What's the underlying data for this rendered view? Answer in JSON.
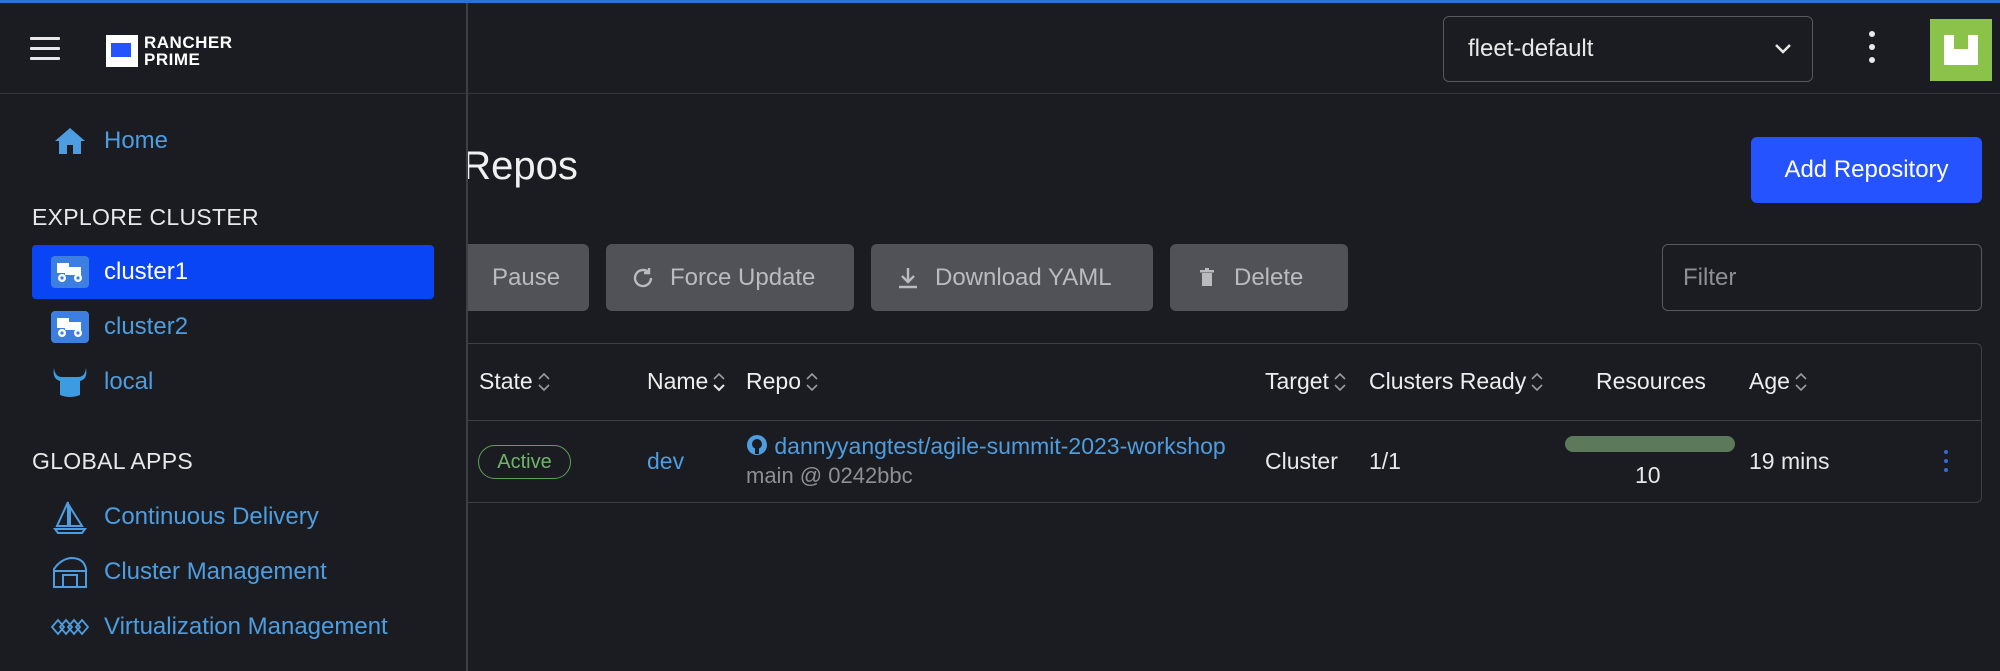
{
  "header": {
    "namespace": "fleet-default"
  },
  "page": {
    "title": ": Repos",
    "add_button": "Add Repository",
    "bulk_actions": {
      "pause": "Pause",
      "force_update": "Force Update",
      "download_yaml": "Download YAML",
      "delete": "Delete"
    },
    "filter_placeholder": "Filter"
  },
  "table": {
    "headers": {
      "state": "State",
      "name": "Name",
      "repo": "Repo",
      "target": "Target",
      "clusters_ready": "Clusters Ready",
      "resources": "Resources",
      "age": "Age"
    },
    "rows": [
      {
        "state": "Active",
        "name": "dev",
        "repo": "dannyyangtest/agile-summit-2023-workshop",
        "branch_commit": "main @ 0242bbc",
        "target": "Cluster",
        "clusters_ready": "1/1",
        "resources": "10",
        "age": "19 mins"
      }
    ]
  },
  "sidenav": {
    "logo_line1": "RANCHER",
    "logo_line2": "PRIME",
    "home": "Home",
    "explore_cluster_heading": "EXPLORE CLUSTER",
    "clusters": [
      "cluster1",
      "cluster2",
      "local"
    ],
    "global_apps_heading": "GLOBAL APPS",
    "apps": [
      "Continuous Delivery",
      "Cluster Management",
      "Virtualization Management"
    ]
  },
  "colors": {
    "accent": "#2453ff",
    "active_nav": "#0a45f5",
    "link": "#4d9de0",
    "status_active": "#6db568",
    "background": "#1b1c21"
  }
}
